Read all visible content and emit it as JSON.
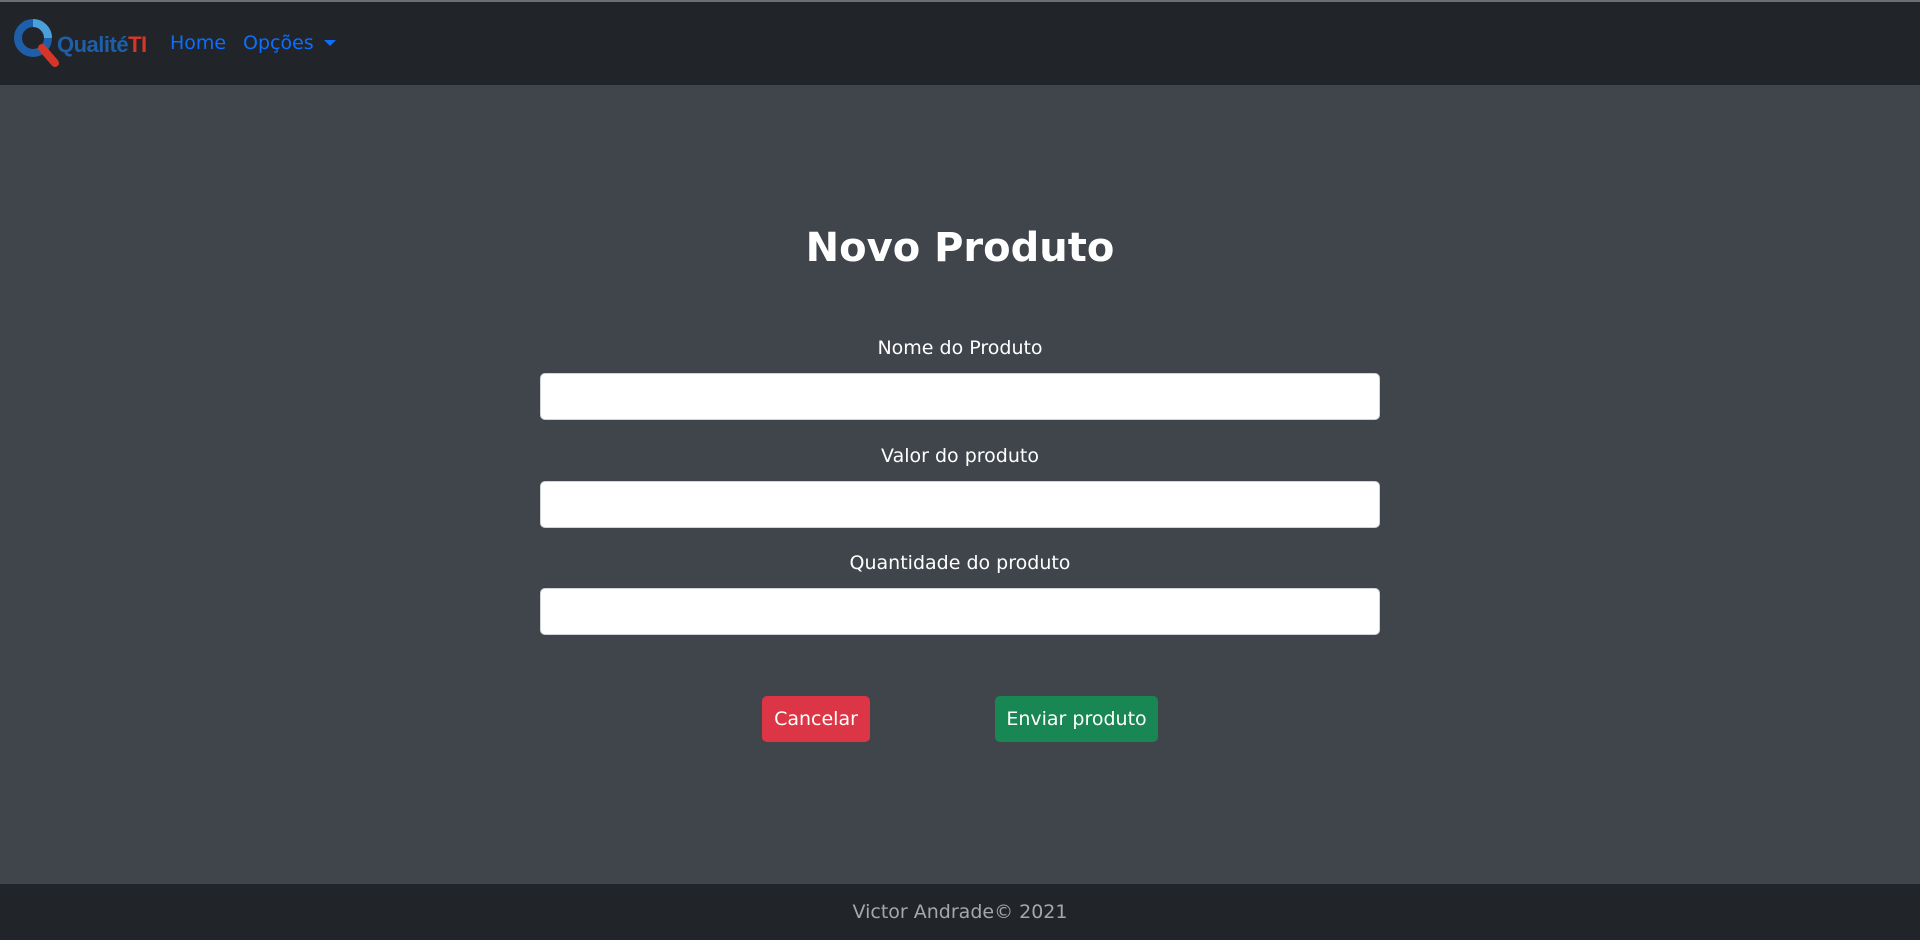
{
  "navbar": {
    "logo_text_1": "Qualité",
    "logo_text_2": "TI",
    "home_label": "Home",
    "options_label": "Opções"
  },
  "page": {
    "title": "Novo Produto"
  },
  "form": {
    "fields": [
      {
        "label": "Nome do Produto",
        "value": "",
        "placeholder": ""
      },
      {
        "label": "Valor do produto",
        "value": "",
        "placeholder": ""
      },
      {
        "label": "Quantidade do produto",
        "value": "",
        "placeholder": ""
      }
    ],
    "cancel_label": "Cancelar",
    "submit_label": "Enviar produto"
  },
  "footer": {
    "text": "Victor Andrade© 2021"
  },
  "colors": {
    "navbar_bg": "#212529",
    "main_bg": "#40454b",
    "link": "#0d6efd",
    "danger": "#dc3545",
    "success": "#198754"
  },
  "icons": {
    "logo": "magnifier-logo-icon",
    "dropdown": "caret-down-icon"
  }
}
